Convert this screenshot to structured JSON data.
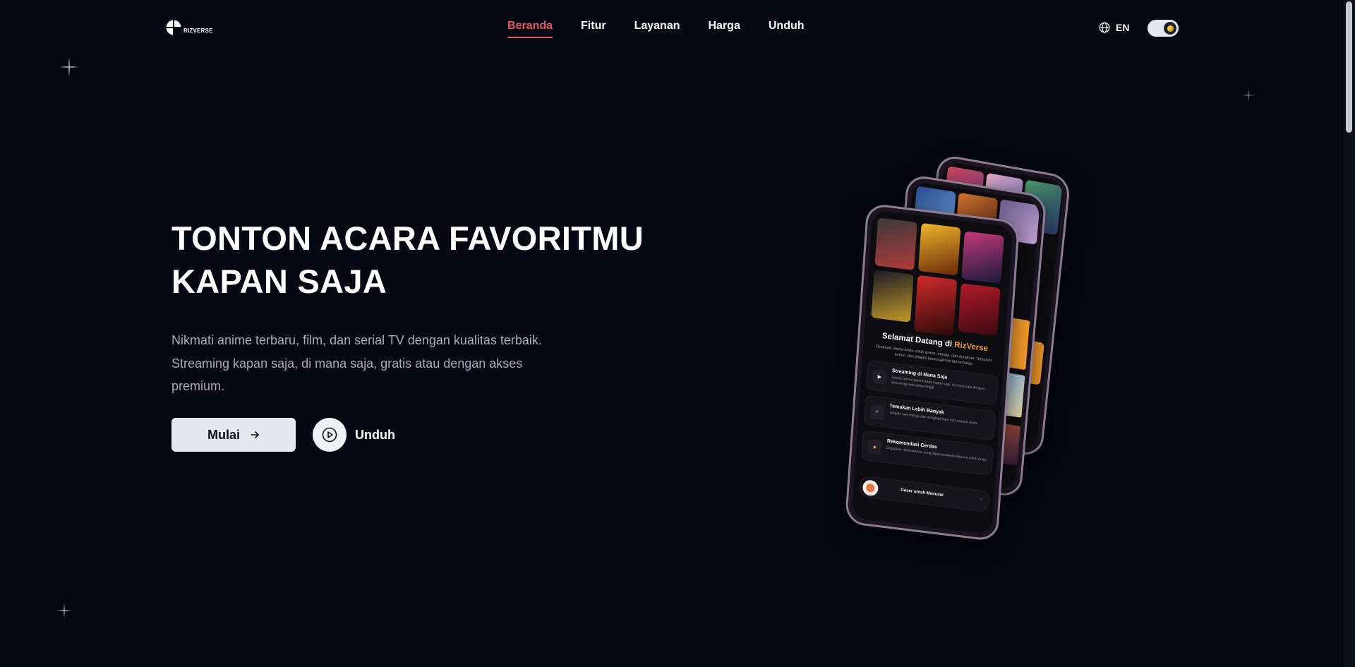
{
  "header": {
    "logo_text": "RIZVERSE",
    "nav": [
      {
        "label": "Beranda",
        "active": true
      },
      {
        "label": "Fitur",
        "active": false
      },
      {
        "label": "Layanan",
        "active": false
      },
      {
        "label": "Harga",
        "active": false
      },
      {
        "label": "Unduh",
        "active": false
      }
    ],
    "language": "EN",
    "icons": {
      "language": "globe-icon",
      "theme_toggle": "theme-toggle"
    }
  },
  "hero": {
    "title_line1": "TONTON ACARA FAVORITMU",
    "title_line2": "KAPAN SAJA",
    "description": "Nikmati anime terbaru, film, dan serial TV dengan kualitas terbaik. Streaming kapan saja, di mana saja, gratis atau dengan akses premium.",
    "start_button": "Mulai",
    "download_button": "Unduh"
  },
  "phone_app": {
    "welcome_prefix": "Selamat Datang di",
    "welcome_brand": "RizVerse",
    "welcome_sub": "Destinasi utama Anda untuk anime, manga, dan donghua. Temukan, tonton, dan jelajahi kemungkinan tak terbatas.",
    "features": [
      {
        "title": "Streaming di Mana Saja",
        "desc": "Tonton anime favorit Anda kapan saja, di mana saja dengan streaming berkualitas tinggi",
        "icon": "play-icon"
      },
      {
        "title": "Temukan Lebih Banyak",
        "desc": "Jelajahi seri manga dan donghua baru dari seluruh dunia",
        "icon": "search-icon"
      },
      {
        "title": "Rekomendasi Cerdas",
        "desc": "Dapatkan rekomendasi yang dipersonalisasi khusus untuk Anda",
        "icon": "star-icon"
      }
    ],
    "swipe_label": "Geser untuk Memulai"
  },
  "colors": {
    "background": "#050812",
    "accent_nav": "#e05a5a",
    "brand_orange": "#f59a2a",
    "text_muted": "#a7acbd"
  }
}
